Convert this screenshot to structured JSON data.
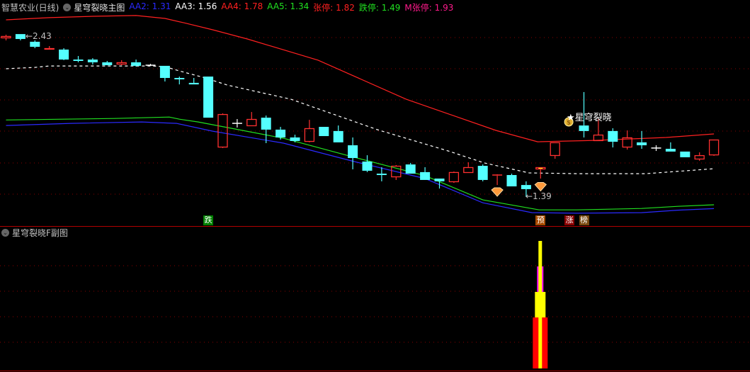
{
  "header": {
    "stock_name": "智慧农业(日线)",
    "indicator_icon": "chevron-down-circle-icon",
    "main_indicator": "星穹裂晓主图",
    "values": [
      {
        "label": "AA2: 1.31",
        "color": "#2a2aff"
      },
      {
        "label": "AA3: 1.56",
        "color": "#ffffff"
      },
      {
        "label": "AA4: 1.78",
        "color": "#ff2020"
      },
      {
        "label": "AA5: 1.34",
        "color": "#20e020"
      },
      {
        "label": "张停: 1.82",
        "color": "#ff2020"
      },
      {
        "label": "跌停: 1.49",
        "color": "#20e020"
      },
      {
        "label": "M张停: 1.93",
        "color": "#ff1a8c"
      }
    ]
  },
  "sub_header": {
    "icon": "chevron-down-circle-icon",
    "title": "星穹裂晓F副图"
  },
  "annotations": {
    "high_label": "←2.43",
    "low_label": "←1.39",
    "signal_label": "★星穹裂晓",
    "signal_icon": "money-bag-icon",
    "diamond_icon": "diamond-icon"
  },
  "markers": [
    {
      "text": "跌",
      "index": 14,
      "bg": "#008000"
    },
    {
      "text": "预",
      "index": 37,
      "bg": "#a84a00"
    },
    {
      "text": "涨",
      "index": 39,
      "bg": "#8a0000"
    },
    {
      "text": "榜",
      "index": 40,
      "bg": "#7a4a10"
    }
  ],
  "colors": {
    "up": "#ff3030",
    "down": "#54ffff",
    "flat": "#ffffff",
    "grid": "#8a0000",
    "highlight": "#ffff00",
    "separator": "#b00000"
  },
  "chart_data": [
    {
      "type": "candlestick",
      "grid": true,
      "xlabel": "",
      "ylabel": "",
      "candles": [
        [
          2.421,
          2.444,
          2.407,
          2.435
        ],
        [
          2.448,
          2.448,
          2.407,
          2.416
        ],
        [
          2.398,
          2.407,
          2.356,
          2.365
        ],
        [
          2.347,
          2.37,
          2.347,
          2.356
        ],
        [
          2.347,
          2.356,
          2.278,
          2.282
        ],
        [
          2.282,
          2.305,
          2.264,
          2.273
        ],
        [
          2.282,
          2.291,
          2.25,
          2.264
        ],
        [
          2.264,
          2.273,
          2.245,
          2.245
        ],
        [
          2.25,
          2.278,
          2.245,
          2.264
        ],
        [
          2.264,
          2.282,
          2.236,
          2.241
        ],
        [
          2.245,
          2.254,
          2.241,
          2.245
        ],
        [
          2.241,
          2.241,
          2.139,
          2.162
        ],
        [
          2.162,
          2.171,
          2.12,
          2.153
        ],
        [
          2.13,
          2.162,
          2.12,
          2.12
        ],
        [
          2.171,
          2.171,
          1.903,
          1.903
        ],
        [
          1.709,
          1.931,
          1.705,
          1.926
        ],
        [
          1.866,
          1.894,
          1.839,
          1.866
        ],
        [
          1.848,
          1.94,
          1.848,
          1.894
        ],
        [
          1.903,
          1.917,
          1.737,
          1.825
        ],
        [
          1.825,
          1.843,
          1.76,
          1.774
        ],
        [
          1.774,
          1.792,
          1.742,
          1.751
        ],
        [
          1.746,
          1.889,
          1.742,
          1.834
        ],
        [
          1.843,
          1.843,
          1.783,
          1.783
        ],
        [
          1.816,
          1.852,
          1.742,
          1.742
        ],
        [
          1.723,
          1.774,
          1.566,
          1.64
        ],
        [
          1.617,
          1.658,
          1.548,
          1.557
        ],
        [
          1.538,
          1.58,
          1.488,
          1.529
        ],
        [
          1.515,
          1.594,
          1.497,
          1.589
        ],
        [
          1.598,
          1.608,
          1.538,
          1.538
        ],
        [
          1.548,
          1.58,
          1.497,
          1.497
        ],
        [
          1.506,
          1.506,
          1.441,
          1.488
        ],
        [
          1.483,
          1.552,
          1.478,
          1.548
        ],
        [
          1.543,
          1.612,
          1.543,
          1.58
        ],
        [
          1.589,
          1.598,
          1.488,
          1.497
        ],
        [
          1.525,
          1.534,
          1.464,
          1.529
        ],
        [
          1.529,
          1.538,
          1.455,
          1.455
        ],
        [
          1.464,
          1.488,
          1.386,
          1.437
        ],
        [
          1.566,
          1.58,
          1.506,
          1.58
        ],
        [
          1.654,
          1.742,
          1.635,
          1.742
        ],
        null,
        [
          1.852,
          2.07,
          1.774,
          1.816
        ],
        [
          1.751,
          1.894,
          1.751,
          1.792
        ],
        [
          1.816,
          1.834,
          1.709,
          1.746
        ],
        [
          1.709,
          1.82,
          1.695,
          1.774
        ],
        [
          1.742,
          1.816,
          1.7,
          1.723
        ],
        [
          1.705,
          1.723,
          1.686,
          1.705
        ],
        [
          1.7,
          1.742,
          1.682,
          1.682
        ],
        [
          1.682,
          1.682,
          1.645,
          1.645
        ],
        [
          1.631,
          1.677,
          1.622,
          1.658
        ],
        [
          1.658,
          1.76,
          1.654,
          1.76
        ]
      ],
      "highlight_candles": [
        34,
        37
      ],
      "diamond_signals": [
        {
          "index": 34,
          "price": 1.455
        },
        {
          "index": 37,
          "price": 1.49
        }
      ],
      "signal_index": 39,
      "high_point": {
        "index": 1,
        "price": 2.43
      },
      "low_point": {
        "index": 36,
        "price": 1.39
      },
      "series": [
        {
          "name": "AA4",
          "color": "#ff2020",
          "style": "solid",
          "points": [
            [
              0,
              2.541
            ],
            [
              3,
              2.555
            ],
            [
              6,
              2.564
            ],
            [
              9,
              2.569
            ],
            [
              11,
              2.55
            ],
            [
              12.3,
              2.522
            ],
            [
              14.3,
              2.476
            ],
            [
              16.7,
              2.416
            ],
            [
              21.6,
              2.278
            ],
            [
              27.7,
              2.023
            ],
            [
              33.9,
              1.82
            ],
            [
              36.8,
              1.746
            ],
            [
              40.8,
              1.755
            ],
            [
              45.7,
              1.774
            ],
            [
              49,
              1.797
            ]
          ]
        },
        {
          "name": "AA3",
          "color": "#ffffff",
          "style": "dashed",
          "points": [
            [
              0,
              2.222
            ],
            [
              2,
              2.231
            ],
            [
              3,
              2.24
            ],
            [
              10,
              2.24
            ],
            [
              11,
              2.236
            ],
            [
              12,
              2.208
            ],
            [
              13.8,
              2.162
            ],
            [
              15.3,
              2.116
            ],
            [
              19.7,
              2.024
            ],
            [
              25.7,
              1.825
            ],
            [
              30.6,
              1.686
            ],
            [
              33.1,
              1.608
            ],
            [
              36.2,
              1.543
            ],
            [
              39.5,
              1.538
            ],
            [
              44.3,
              1.538
            ],
            [
              49,
              1.57
            ]
          ]
        },
        {
          "name": "AA5",
          "color": "#20e020",
          "style": "solid",
          "points": [
            [
              0,
              1.888
            ],
            [
              4,
              1.893
            ],
            [
              7.5,
              1.898
            ],
            [
              11.3,
              1.907
            ],
            [
              12,
              1.893
            ],
            [
              13.3,
              1.875
            ],
            [
              14.3,
              1.857
            ],
            [
              19.2,
              1.769
            ],
            [
              24.1,
              1.645
            ],
            [
              29,
              1.525
            ],
            [
              33,
              1.367
            ],
            [
              36.9,
              1.302
            ],
            [
              39.5,
              1.302
            ],
            [
              44,
              1.311
            ],
            [
              46.5,
              1.325
            ],
            [
              49,
              1.335
            ]
          ]
        },
        {
          "name": "AA2",
          "color": "#2a2aff",
          "style": "solid",
          "points": [
            [
              0,
              1.852
            ],
            [
              4.5,
              1.866
            ],
            [
              9.4,
              1.875
            ],
            [
              11.8,
              1.866
            ],
            [
              14.3,
              1.815
            ],
            [
              19.2,
              1.737
            ],
            [
              24.1,
              1.617
            ],
            [
              29,
              1.506
            ],
            [
              33,
              1.348
            ],
            [
              36.4,
              1.284
            ],
            [
              39.5,
              1.28
            ],
            [
              44,
              1.284
            ],
            [
              46.5,
              1.3
            ],
            [
              49,
              1.31
            ]
          ]
        }
      ]
    },
    {
      "type": "bar",
      "grid": true,
      "index": 37,
      "stacks": [
        {
          "color": "#ff0000",
          "from": 0,
          "to": 2,
          "width": "wide"
        },
        {
          "color": "#ffff00",
          "from": 2,
          "to": 3,
          "width": "medium"
        },
        {
          "color": "#ff00ff",
          "from": 3,
          "to": 4,
          "width": "narrow"
        },
        {
          "color": "#ffff00",
          "from": 0,
          "to": 5,
          "width": "thin"
        }
      ]
    }
  ]
}
